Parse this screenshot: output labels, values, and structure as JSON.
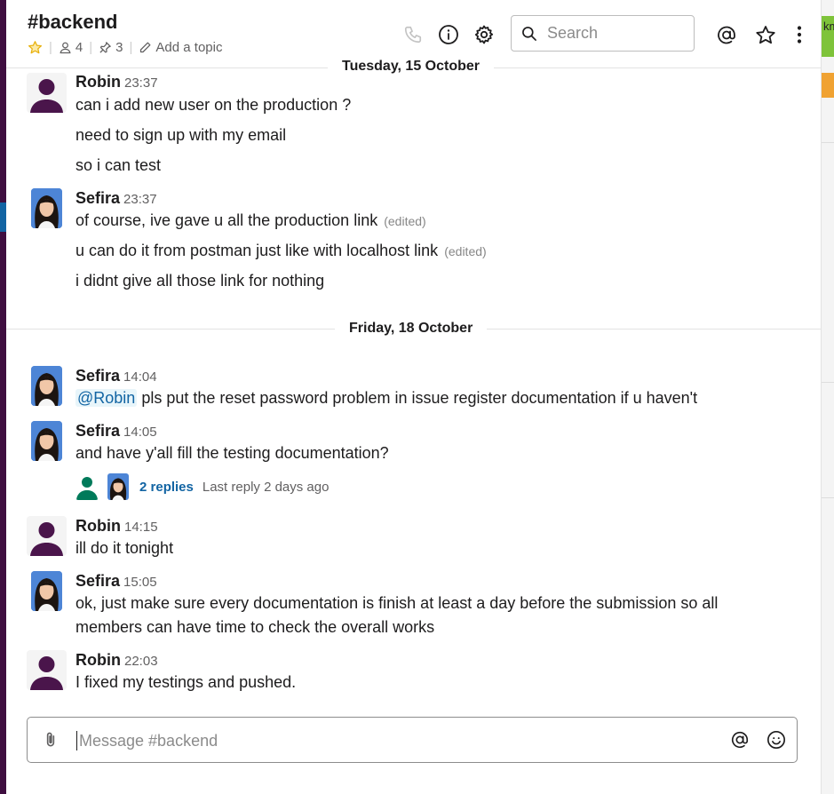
{
  "header": {
    "channel_name": "#backend",
    "member_count": "4",
    "pinned_count": "3",
    "add_topic": "Add a topic",
    "search_placeholder": "Search",
    "icons": [
      "star-icon",
      "person-icon",
      "pin-icon",
      "pencil-icon",
      "phone-icon",
      "info-icon",
      "gear-icon",
      "search-icon",
      "at-icon",
      "star-icon",
      "more-vertical-icon"
    ]
  },
  "right_strip": {
    "text_fragment": "km"
  },
  "days": [
    {
      "label": "Tuesday, 15 October"
    },
    {
      "label": "Friday, 18 October"
    }
  ],
  "messages": [
    {
      "author": "Robin",
      "time": "23:37",
      "lines": [
        {
          "text": "can i add new user on the production ?"
        },
        {
          "text": "need to sign up with my email"
        },
        {
          "text": "so i can test"
        }
      ]
    },
    {
      "author": "Sefira",
      "time": "23:37",
      "lines": [
        {
          "text": "of course, ive gave u all the production link",
          "edited": "(edited)"
        },
        {
          "text": "u can do it from postman just like with localhost link",
          "edited": "(edited)"
        },
        {
          "text": "i didnt give all those link for nothing"
        }
      ]
    },
    {
      "author": "Sefira",
      "time": "14:04",
      "mention": "@Robin",
      "lines": [
        {
          "text": " pls put the reset password problem in issue register documentation if u haven't"
        }
      ]
    },
    {
      "author": "Sefira",
      "time": "14:05",
      "lines": [
        {
          "text": "and have y'all fill the testing documentation?"
        }
      ],
      "thread": {
        "replies": "2 replies",
        "last_reply": "Last reply 2 days ago"
      }
    },
    {
      "author": "Robin",
      "time": "14:15",
      "lines": [
        {
          "text": "ill do it tonight"
        }
      ]
    },
    {
      "author": "Sefira",
      "time": "15:05",
      "lines": [
        {
          "text": "ok, just make sure every documentation is finish at least a day before the submission so all"
        },
        {
          "text": "members can have time to check the overall works"
        }
      ]
    },
    {
      "author": "Robin",
      "time": "22:03",
      "lines": [
        {
          "text": "I fixed my testings and pushed."
        }
      ]
    }
  ],
  "composer": {
    "placeholder": "Message #backend",
    "icons": [
      "paperclip-icon",
      "at-icon",
      "emoji-icon"
    ]
  },
  "colors": {
    "sidebar": "#3f0e40",
    "selection": "#1264a3",
    "link": "#1264a3",
    "robin_avatar": "#4a154b",
    "thread_avatar": "#007a5a",
    "star": "#e8b10e"
  }
}
